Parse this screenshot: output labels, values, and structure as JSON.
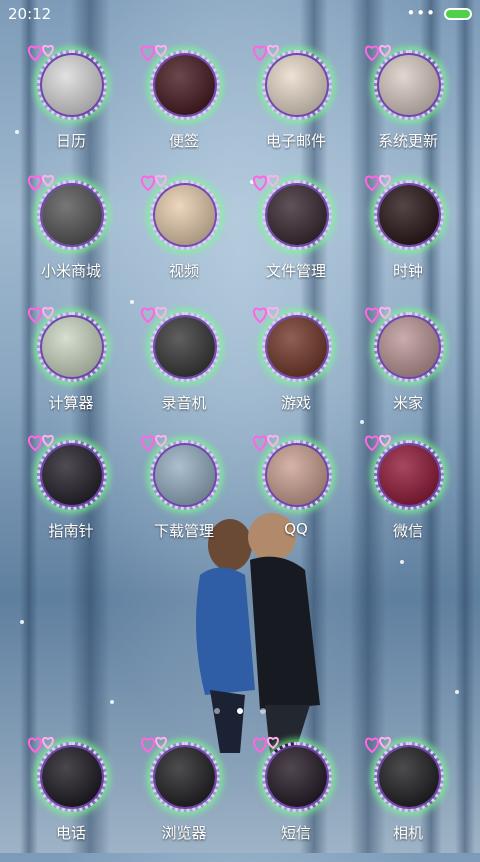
{
  "status_bar": {
    "time": "20:12",
    "more": "•••"
  },
  "apps": [
    {
      "id": "calendar",
      "label": "日历",
      "tint": "#d8d8d8"
    },
    {
      "id": "notes",
      "label": "便签",
      "tint": "#3a0a12"
    },
    {
      "id": "email",
      "label": "电子邮件",
      "tint": "#e8d8c8"
    },
    {
      "id": "updater",
      "label": "系统更新",
      "tint": "#d8c8c0"
    },
    {
      "id": "mi-store",
      "label": "小米商城",
      "tint": "#4a4a4a"
    },
    {
      "id": "video",
      "label": "视频",
      "tint": "#e6c9a8"
    },
    {
      "id": "file-manager",
      "label": "文件管理",
      "tint": "#2a1a22"
    },
    {
      "id": "clock",
      "label": "时钟",
      "tint": "#1a0608"
    },
    {
      "id": "calculator",
      "label": "计算器",
      "tint": "#c9d6c0"
    },
    {
      "id": "recorder",
      "label": "录音机",
      "tint": "#2a2a2a"
    },
    {
      "id": "games",
      "label": "游戏",
      "tint": "#6a2a1a"
    },
    {
      "id": "mi-home",
      "label": "米家",
      "tint": "#b89090"
    },
    {
      "id": "compass",
      "label": "指南针",
      "tint": "#15101c"
    },
    {
      "id": "downloads",
      "label": "下载管理",
      "tint": "#8faac0"
    },
    {
      "id": "qq",
      "label": "QQ",
      "tint": "#c89a8a"
    },
    {
      "id": "wechat",
      "label": "微信",
      "tint": "#8a0a2a"
    }
  ],
  "dock": [
    {
      "id": "phone",
      "label": "电话",
      "tint": "#0d0a12"
    },
    {
      "id": "browser",
      "label": "浏览器",
      "tint": "#121014"
    },
    {
      "id": "messages",
      "label": "短信",
      "tint": "#160a16"
    },
    {
      "id": "camera",
      "label": "相机",
      "tint": "#101014"
    }
  ],
  "pager": {
    "count": 3,
    "active": 1
  }
}
